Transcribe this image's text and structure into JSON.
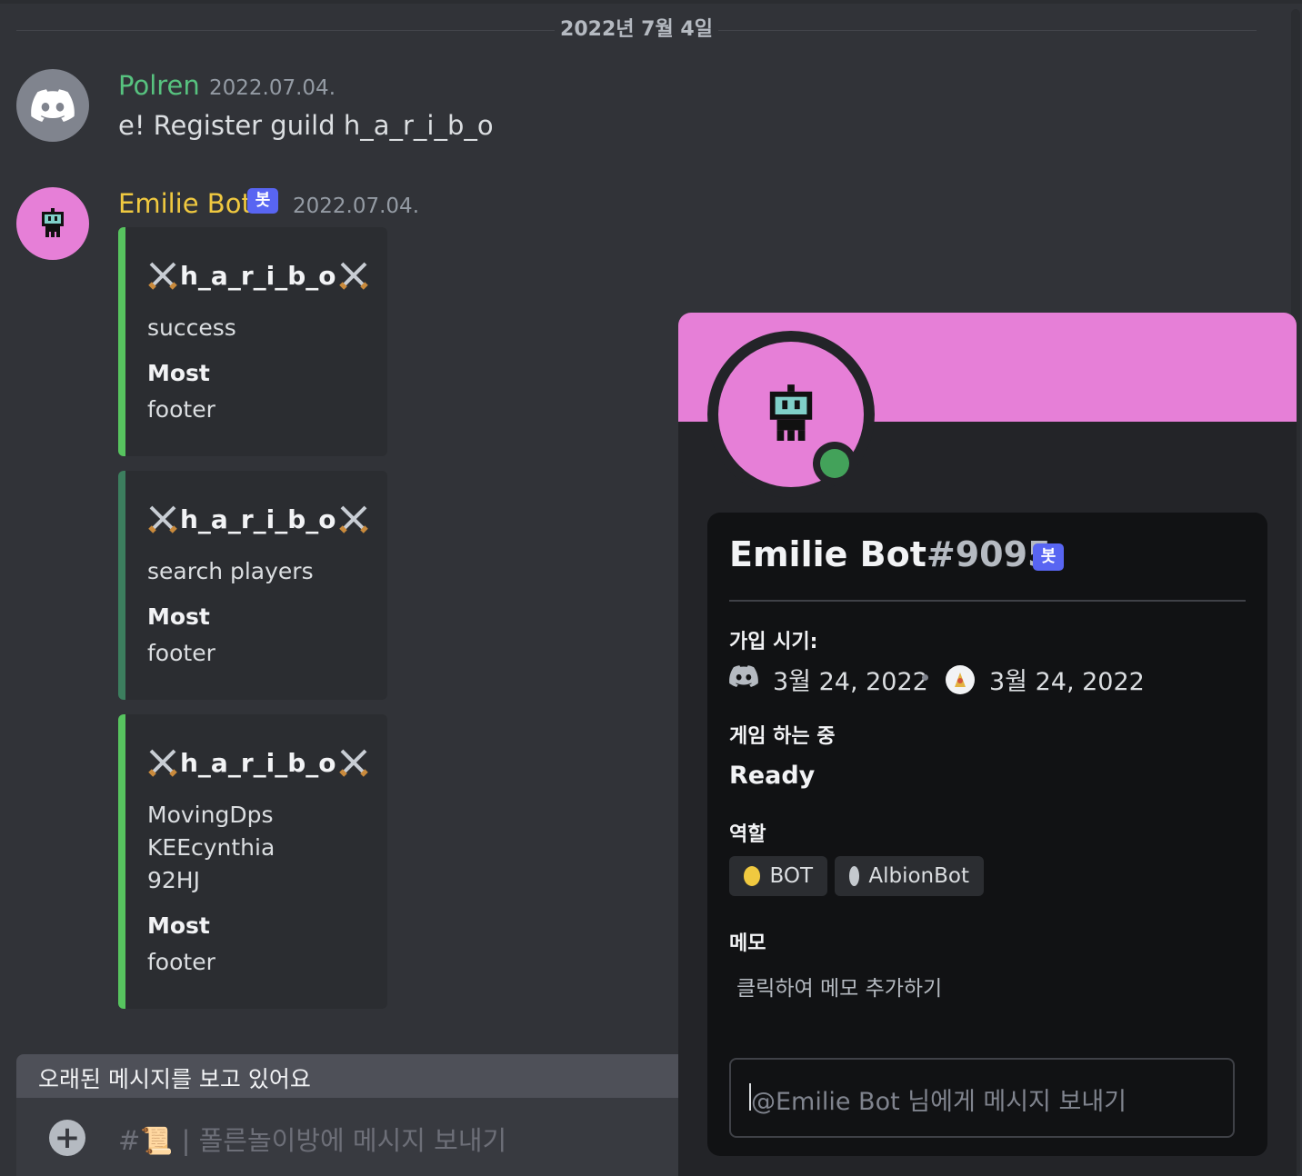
{
  "date_divider": "2022년 7월 4일",
  "messages": [
    {
      "author": "Polren",
      "timestamp": "2022.07.04.",
      "text": "e! Register guild h_a_r_i_b_o",
      "avatar_icon": "discord-logo-icon"
    },
    {
      "author": "Emilie Bot",
      "bot_tag": "봇",
      "timestamp": "2022.07.04.",
      "avatar_icon": "robot-icon"
    }
  ],
  "embeds": [
    {
      "title": "h_a_r_i_b_o",
      "title_icon": "crossed-swords-icon",
      "description": [
        "success"
      ],
      "field_name": "Most",
      "field_value": "footer",
      "color": "#57c45f"
    },
    {
      "title": "h_a_r_i_b_o",
      "title_icon": "crossed-swords-icon",
      "description": [
        "search players"
      ],
      "field_name": "Most",
      "field_value": "footer",
      "color": "#3c7e5e"
    },
    {
      "title": "h_a_r_i_b_o",
      "title_icon": "crossed-swords-icon",
      "description": [
        "MovingDps",
        "KEEcynthia",
        "92HJ"
      ],
      "field_name": "Most",
      "field_value": "footer",
      "color": "#57c45f"
    }
  ],
  "old_messages_banner": "오래된 메시지를 보고 있어요",
  "composer": {
    "placeholder": "#📜 | 폴른놀이방에 메시지 보내기"
  },
  "profile": {
    "name": "Emilie Bot",
    "discriminator": "#9095",
    "bot_tag": "봇",
    "banner_color": "#e67fd7",
    "status": "online",
    "member_since_label": "가입 시기:",
    "discord_join_date": "3월 24, 2022",
    "server_join_date": "3월 24, 2022",
    "playing_label": "게임 하는 중",
    "playing_value": "Ready",
    "roles_label": "역할",
    "roles": [
      {
        "name": "BOT",
        "color": "#f0c940"
      },
      {
        "name": "AlbionBot",
        "color": "#c4c9ce"
      }
    ],
    "memo_label": "메모",
    "memo_placeholder": "클릭하여 메모 추가하기",
    "dm_placeholder": "@Emilie Bot 님에게 메시지 보내기"
  }
}
